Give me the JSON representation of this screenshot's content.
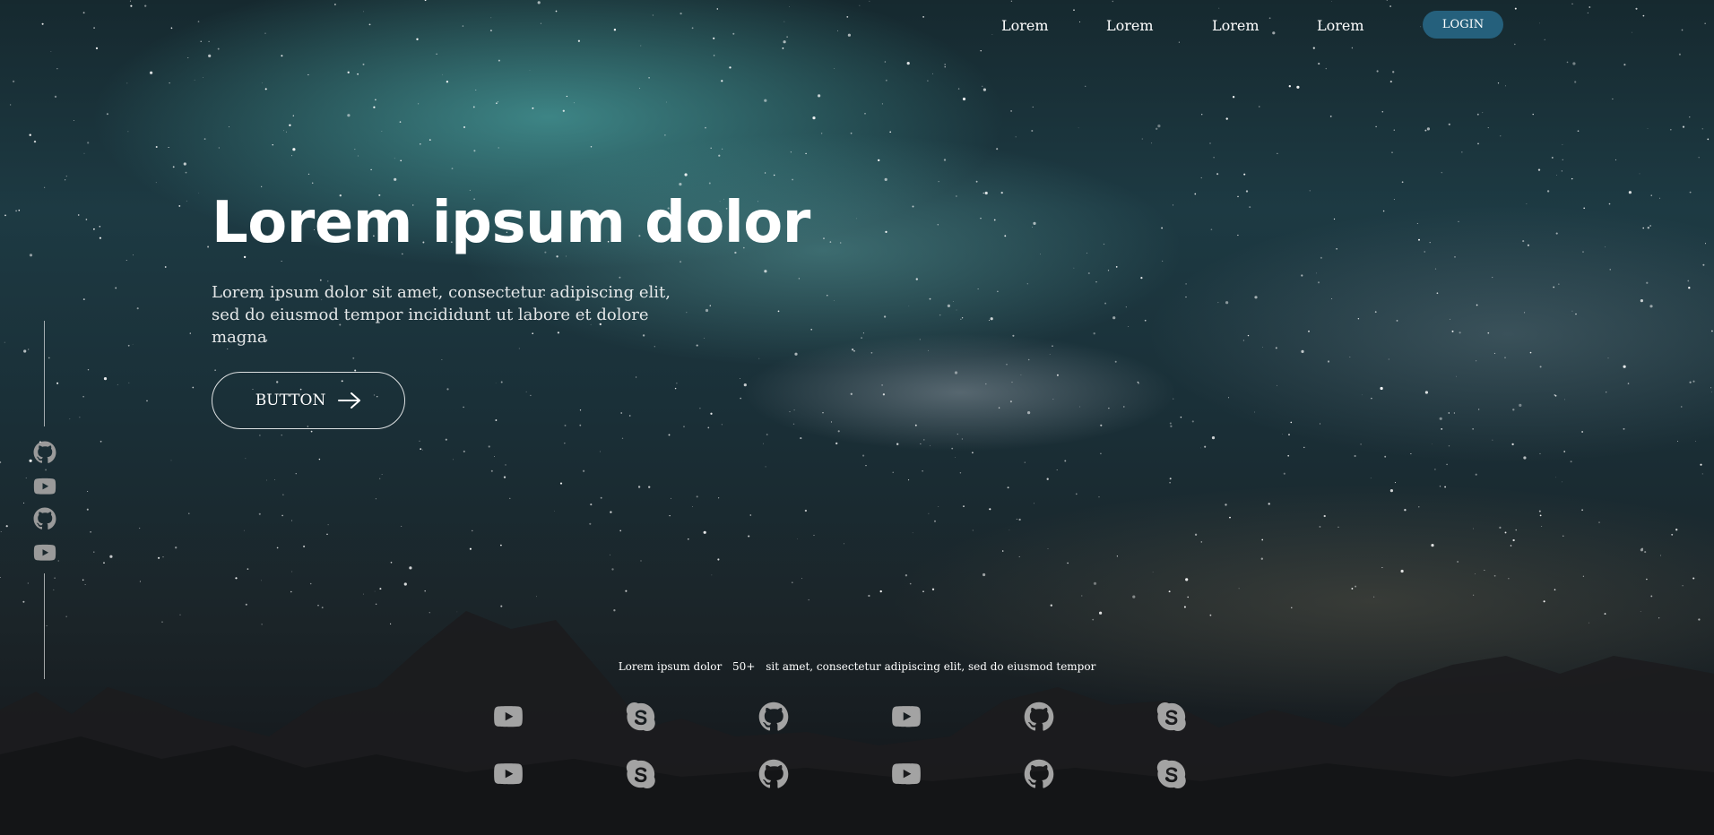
{
  "nav": {
    "items": [
      "Lorem",
      "Lorem",
      "Lorem",
      "Lorem"
    ],
    "login_label": "LOGIN"
  },
  "hero": {
    "title": "Lorem ipsum dolor",
    "subtitle": "Lorem ipsum dolor sit amet, consectetur adipiscing elit, sed do eiusmod tempor incididunt ut labore et dolore magna",
    "button_label": "BUTTON"
  },
  "social_rail": {
    "icons": [
      "github-icon",
      "youtube-icon",
      "github-icon",
      "youtube-icon"
    ]
  },
  "stats": {
    "label": "Lorem ipsum dolor",
    "count": "50+",
    "text": "sit amet, consectetur adipiscing elit, sed do eiusmod tempor"
  },
  "icon_grid": {
    "rows": [
      [
        "youtube-icon",
        "skype-icon",
        "github-icon",
        "youtube-icon",
        "github-icon",
        "skype-icon"
      ],
      [
        "youtube-icon",
        "skype-icon",
        "github-icon",
        "youtube-icon",
        "github-icon",
        "skype-icon"
      ]
    ]
  },
  "colors": {
    "login_button": "#25607c",
    "icon_gray": "#a3a3a3",
    "sky_teal": "#5ac8c3"
  }
}
